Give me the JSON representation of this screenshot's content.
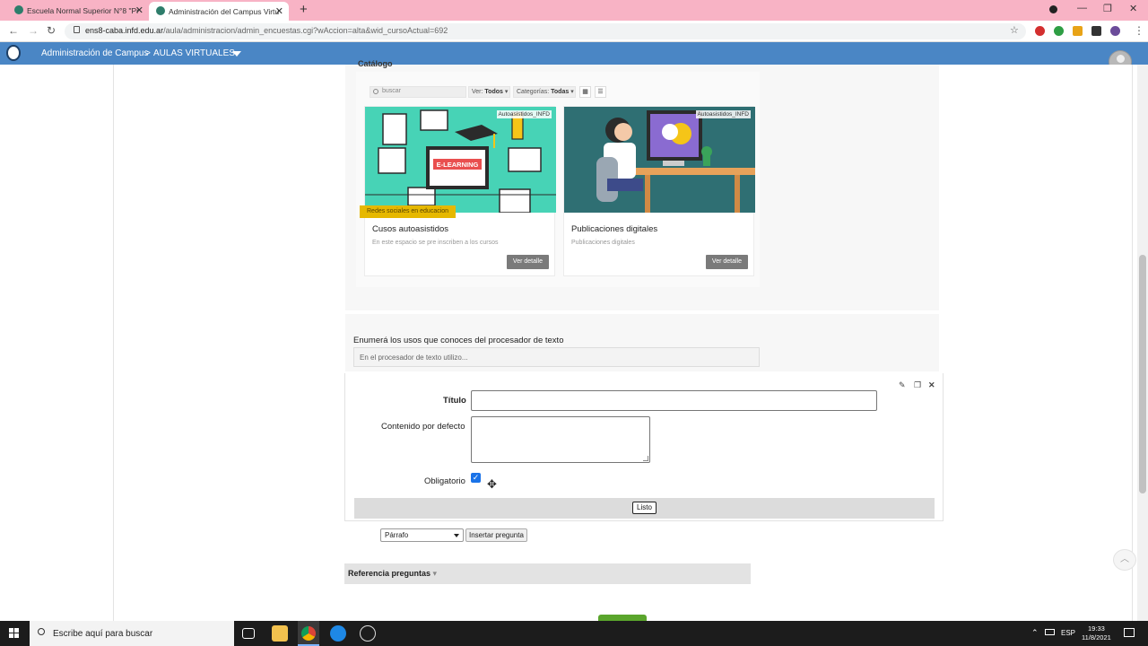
{
  "browser": {
    "tabs": [
      {
        "title": "Escuela Normal Superior N°8 \"Pr",
        "active": false
      },
      {
        "title": "Administración del Campus Virtu",
        "active": true
      }
    ],
    "url_host": "ens8-caba.infd.edu.ar",
    "url_path": "/aula/administracion/admin_encuestas.cgi?wAccion=alta&wid_cursoActual=692"
  },
  "header": {
    "breadcrumb_root": "Administración de Campus",
    "separator": ">",
    "breadcrumb_current": "AULAS VIRTUALES"
  },
  "catalog": {
    "title": "Catálogo",
    "search_placeholder": "buscar",
    "filter_ver_label": "Ver:",
    "filter_ver_value": "Todos",
    "filter_cat_label": "Categorías:",
    "filter_cat_value": "Todas",
    "cards": [
      {
        "tag": "Autoasistidos_INFD",
        "image_text": "E-LEARNING",
        "ribbon": "Redes sociales en educacion",
        "title": "Cusos autoasistidos",
        "description": "En este espacio se pre inscriben a los cursos",
        "button": "Ver detalle"
      },
      {
        "tag": "Autoasistidos_INFD",
        "title": "Publicaciones digitales",
        "description": "Publicaciones digitales",
        "button": "Ver detalle"
      }
    ]
  },
  "question_preview": {
    "label": "Enumerá los usos que conoces del procesador de texto",
    "input_value": "En el procesador de texto utilizo..."
  },
  "edit_form": {
    "titulo_label": "Título",
    "titulo_value": "",
    "contenido_label": "Contenido por defecto",
    "obligatorio_label": "Obligatorio",
    "obligatorio_checked": true,
    "listo_button": "Listo"
  },
  "insert": {
    "type_value": "Párrafo",
    "button": "Insertar pregunta"
  },
  "referencia": {
    "label": "Referencia preguntas",
    "arrow": "▾"
  },
  "taskbar": {
    "search_placeholder": "Escribe aquí para buscar",
    "lang": "ESP",
    "time": "19:33",
    "date": "11/8/2021"
  },
  "colors": {
    "tabbar": "#f8b3c5",
    "header": "#4a86c5",
    "ribbon": "#e6b800",
    "button_gray": "#7a7a7a",
    "checkbox": "#1a73e8"
  }
}
